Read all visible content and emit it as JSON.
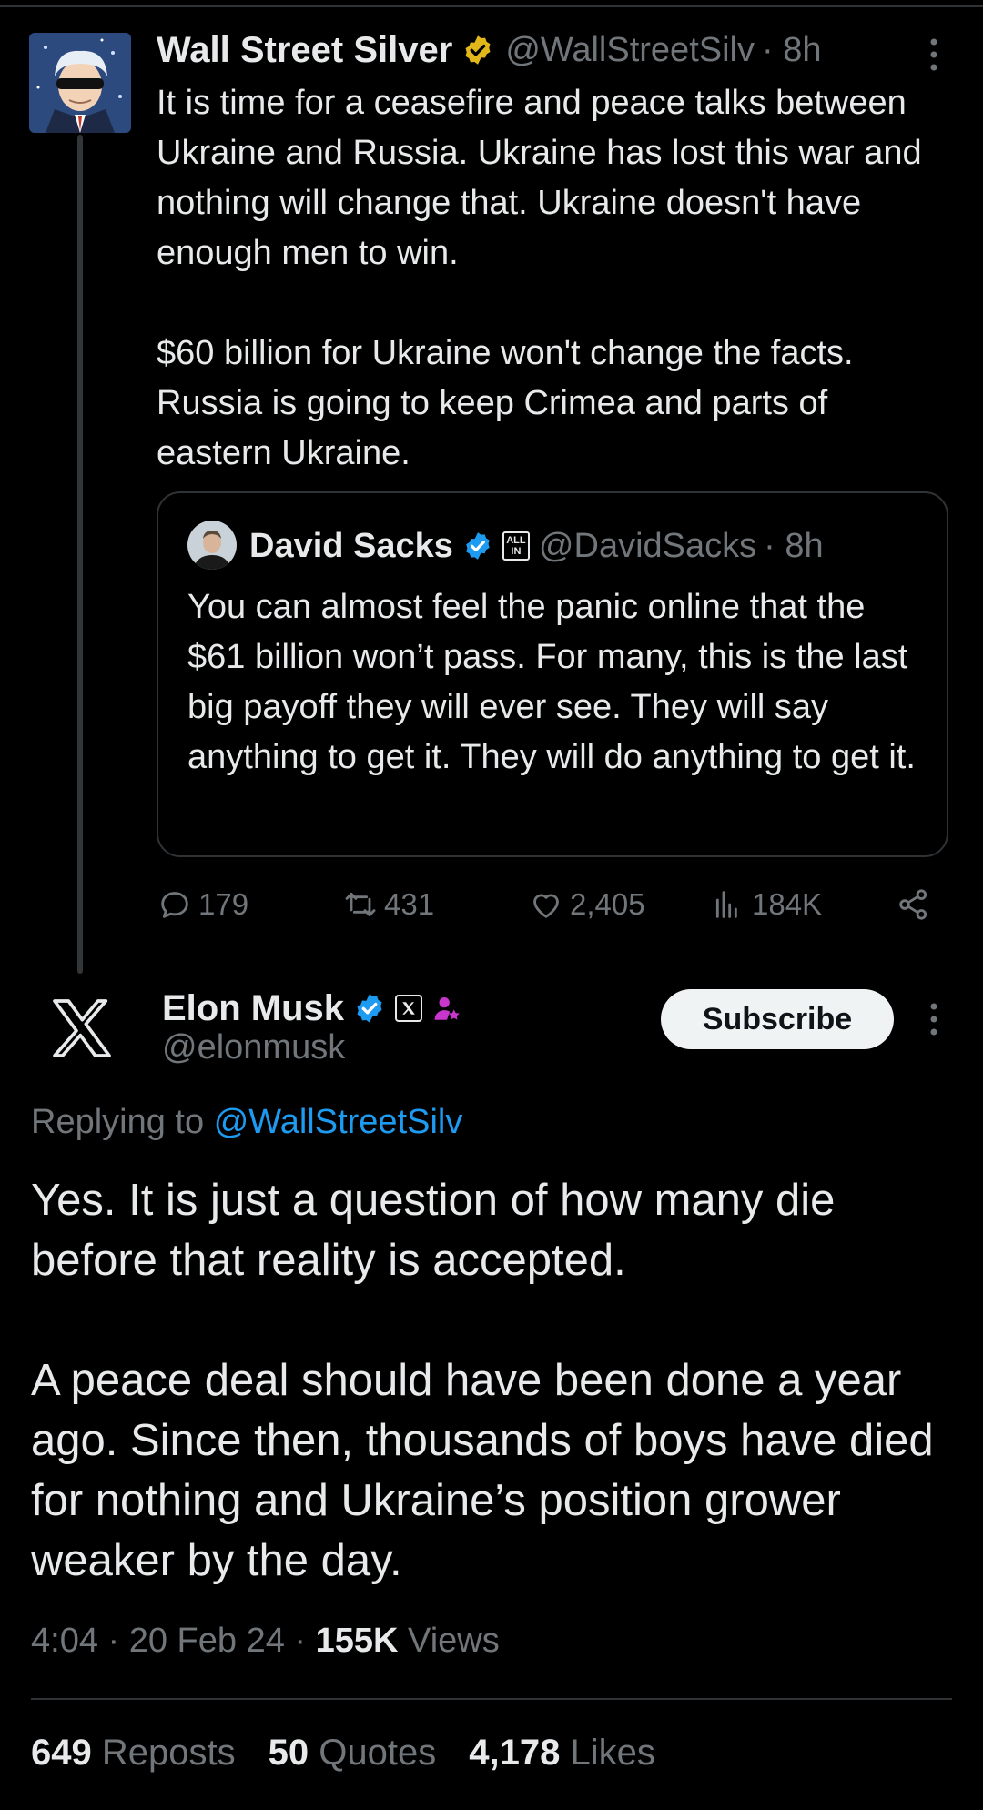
{
  "parent_tweet": {
    "display_name": "Wall Street Silver",
    "handle": "@WallStreetSilv",
    "time": "· 8h",
    "body": "It is time for a ceasefire and peace talks between Ukraine and Russia. Ukraine has lost this war and nothing will change that. Ukraine doesn't have enough men to win.\n\n$60 billion for Ukraine won't change the facts. Russia is going to keep Crimea and parts of eastern Ukraine.",
    "quoted": {
      "display_name": "David Sacks",
      "badge_text_1": "ALL",
      "badge_text_2": "IN",
      "handle": "@DavidSacks",
      "time": "· 8h",
      "body": "You can almost feel the panic online that the $61 billion won’t pass. For many, this is the last big payoff they will ever see. They will say anything to get it. They will do anything to get it."
    },
    "actions": {
      "replies": "179",
      "reposts": "431",
      "likes": "2,405",
      "views": "184K"
    }
  },
  "main_tweet": {
    "display_name": "Elon Musk",
    "handle": "@elonmusk",
    "subscribe_label": "Subscribe",
    "replying_prefix": "Replying to",
    "replying_to": "@WallStreetSilv",
    "body": "Yes. It is just a question of how many die before that reality is accepted.\n\nA peace deal should have been done a year ago. Since then, thousands of boys have died for nothing and Ukraine’s position grower weaker by the day.",
    "timestamp": "4:04 · 20 Feb 24 ·",
    "views_count": "155K",
    "views_label": "Views",
    "stats": {
      "reposts_count": "649",
      "reposts_label": "Reposts",
      "quotes_count": "50",
      "quotes_label": "Quotes",
      "likes_count": "4,178",
      "likes_label": "Likes"
    }
  },
  "colors": {
    "background": "#000000",
    "text_primary": "#e7e9ea",
    "text_secondary": "#71767b",
    "link": "#1d9bf0",
    "gold_badge": "#e2b719",
    "blue_badge": "#1d9bf0",
    "affiliate_purple": "#c936cc"
  },
  "icons": [
    "more-icon",
    "gold-verified-icon",
    "blue-verified-icon",
    "reply-icon",
    "repost-icon",
    "like-icon",
    "views-icon",
    "share-icon",
    "x-logo-icon",
    "x-affiliate-icon",
    "person-badge-icon"
  ]
}
